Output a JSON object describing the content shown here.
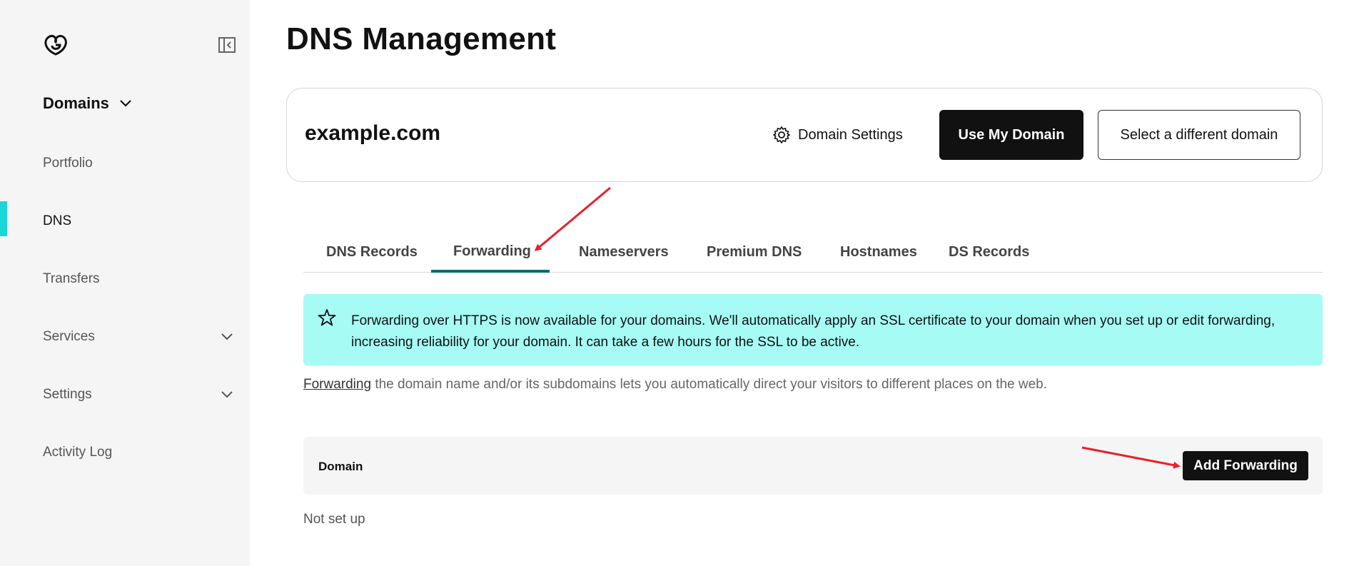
{
  "sidebar": {
    "section_label": "Domains",
    "items": [
      {
        "label": "Portfolio"
      },
      {
        "label": "DNS"
      },
      {
        "label": "Transfers"
      },
      {
        "label": "Services"
      },
      {
        "label": "Settings"
      },
      {
        "label": "Activity Log"
      }
    ]
  },
  "page": {
    "title": "DNS Management"
  },
  "domain_card": {
    "domain": "example.com",
    "settings_label": "Domain Settings",
    "use_domain_label": "Use My Domain",
    "select_domain_label": "Select a different domain"
  },
  "tabs": [
    {
      "label": "DNS Records"
    },
    {
      "label": "Forwarding",
      "active": true
    },
    {
      "label": "Nameservers"
    },
    {
      "label": "Premium DNS"
    },
    {
      "label": "Hostnames"
    },
    {
      "label": "DS Records"
    }
  ],
  "banner": {
    "text": "Forwarding over HTTPS is now available for your domains. We'll automatically apply an SSL certificate to your domain when you set up or edit forwarding, increasing reliability for your domain. It can take a few hours for the SSL to be active."
  },
  "description": {
    "link": "Forwarding",
    "rest": " the domain name and/or its subdomains lets you automatically direct your visitors to different places on the web."
  },
  "table": {
    "header_domain": "Domain",
    "add_button": "Add Forwarding",
    "empty_text": "Not set up"
  },
  "colors": {
    "accent_teal": "#1bd6d6",
    "banner_bg": "#a6fbf5",
    "tab_underline": "#0a6b6b",
    "annotation_arrow": "#e8202a"
  }
}
